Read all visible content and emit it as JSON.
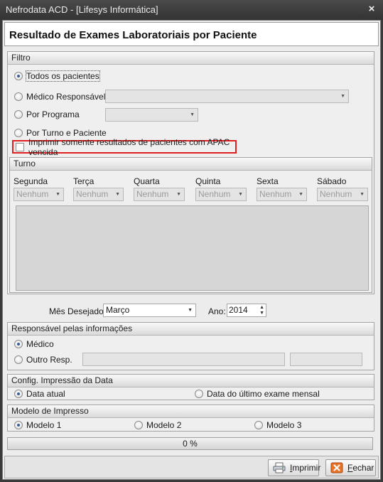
{
  "window": {
    "title": "Nefrodata ACD - [Lifesys Informática]",
    "close": "×"
  },
  "header": {
    "title": "Resultado de Exames Laboratoriais por Paciente"
  },
  "filtro": {
    "title": "Filtro",
    "todos": "Todos os pacientes",
    "medico": "Médico Responsável:",
    "programa": "Por Programa",
    "turno_paciente": "Por Turno e Paciente",
    "apac": "Imprimir somente resultados de pacientes com APAC vencida"
  },
  "turno": {
    "title": "Turno",
    "days": [
      "Segunda",
      "Terça",
      "Quarta",
      "Quinta",
      "Sexta",
      "Sábado"
    ],
    "values": [
      "Nenhum",
      "Nenhum",
      "Nenhum",
      "Nenhum",
      "Nenhum",
      "Nenhum"
    ]
  },
  "periodo": {
    "mes_label": "Mês Desejado:",
    "mes_value": "Março",
    "ano_label": "Ano:",
    "ano_value": "2014"
  },
  "responsavel": {
    "title": "Responsável pelas informações",
    "medico": "Médico",
    "outro": "Outro Resp."
  },
  "config_data": {
    "title": "Config. Impressão da Data",
    "atual": "Data atual",
    "ultimo": "Data do último exame mensal"
  },
  "modelo": {
    "title": "Modelo de Impresso",
    "m1": "Modelo 1",
    "m2": "Modelo 2",
    "m3": "Modelo 3"
  },
  "progress": {
    "label": "0 %",
    "value": 0
  },
  "buttons": {
    "imprimir_first": "I",
    "imprimir_rest": "mprimir",
    "fechar_first": "F",
    "fechar_rest": "echar"
  },
  "colors": {
    "highlight": "#e02020",
    "radio_selected": "#355e9b"
  }
}
